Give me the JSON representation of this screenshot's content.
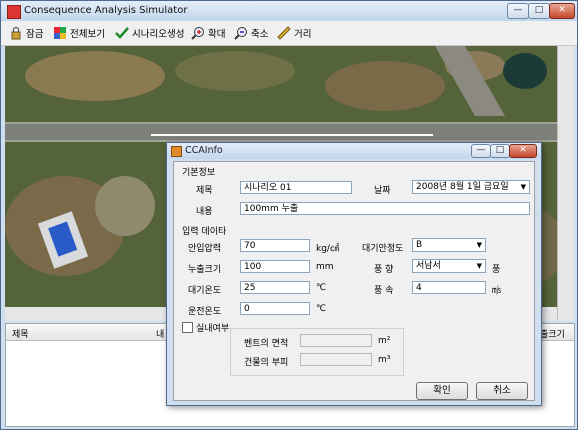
{
  "window": {
    "title": "Consequence Analysis Simulator"
  },
  "toolbar": {
    "lock": "잠금",
    "fullview": "전체보기",
    "scenario": "시나리오생성",
    "zoom_in": "확대",
    "zoom_out": "축소",
    "distance": "거리"
  },
  "grid": {
    "col_title": "제목",
    "col_content_partial": "내",
    "col_size_partial": "출크기"
  },
  "dialog": {
    "title": "CCAInfo",
    "basic_section": "기본정보",
    "title_label": "제목",
    "title_value": "시나리오 01",
    "date_label": "날짜",
    "date_value": "2008년   8월   1일 금요일",
    "content_label": "내용",
    "content_value": "100mm 누출",
    "input_section": "입력 데이타",
    "pressure_label": "안입압력",
    "pressure_value": "70",
    "pressure_unit": "kg/㎠",
    "stability_label": "대기안정도",
    "stability_value": "B",
    "leak_label": "누출크기",
    "leak_value": "100",
    "leak_unit": "mm",
    "wind_dir_label": "풍 향",
    "wind_dir_value": "서남서",
    "wind_dir_unit": "풍",
    "air_temp_label": "대기온도",
    "air_temp_value": "25",
    "air_temp_unit": "℃",
    "wind_speed_label": "풍 속",
    "wind_speed_value": "4",
    "wind_speed_unit": "㎧",
    "op_temp_label": "운전온도",
    "op_temp_value": "0",
    "op_temp_unit": "℃",
    "indoor_label": "실내여부",
    "vent_label": "벤트의 면적",
    "vent_unit": "m²",
    "bldg_label": "건물의 부피",
    "bldg_unit": "m³",
    "ok_button": "확인",
    "cancel_button": "취소"
  }
}
